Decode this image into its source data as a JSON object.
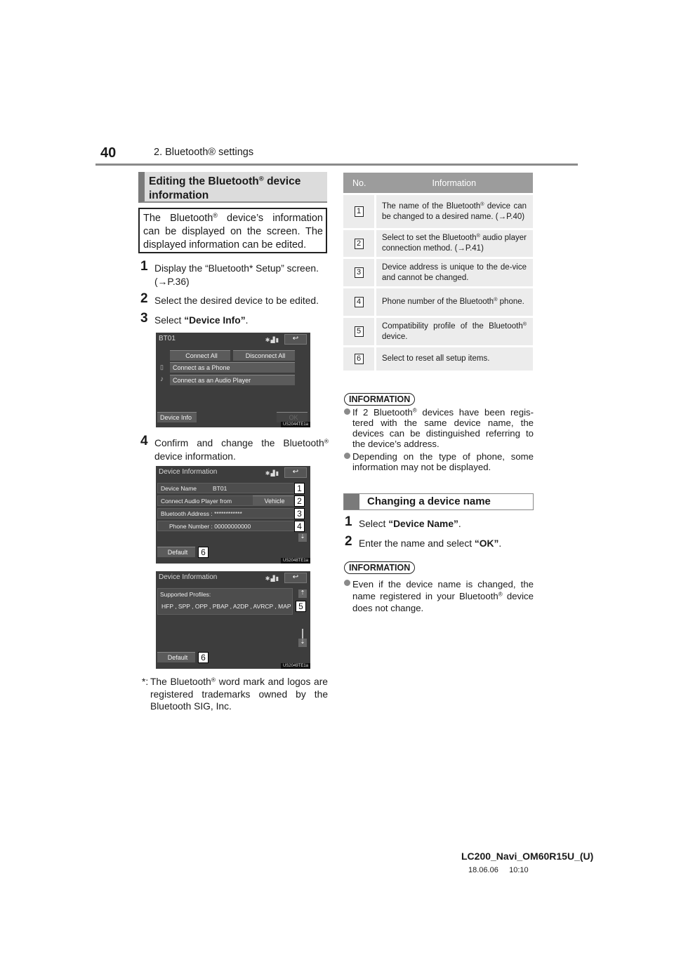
{
  "header": {
    "page_number": "40",
    "section_title": "2. Bluetooth® settings"
  },
  "left": {
    "heading_line1": "Editing the Bluetooth",
    "heading_sup": "®",
    "heading_line1_tail": " device",
    "heading_line2": "information",
    "intro": {
      "pre": "The Bluetooth",
      "sup": "®",
      "post": " device’s information can be displayed on the screen. The displayed information can be edited."
    },
    "steps": [
      {
        "num": "1",
        "text": "Display the “Bluetooth* Setup” screen.",
        "ref": "(→P.36)"
      },
      {
        "num": "2",
        "text": "Select the desired device to be edited."
      },
      {
        "num": "3",
        "pre": "Select ",
        "bold": "“Device Info”",
        "post": "."
      },
      {
        "num": "4",
        "pre": "Confirm and change the Bluetooth",
        "sup": "®",
        "post": "device information."
      }
    ],
    "screen1": {
      "title": "BT01",
      "status_icons": "bluetooth-signal-battery",
      "buttons": {
        "connect_all": "Connect All",
        "disconnect_all": "Disconnect All",
        "connect_phone": "Connect as a Phone",
        "connect_audio": "Connect as an Audio Player",
        "device_info": "Device Info",
        "ok": "OK"
      },
      "code": "US2044TE1a"
    },
    "screen2": {
      "title": "Device Information",
      "rows": {
        "device_name_label": "Device Name",
        "device_name_value": "BT01",
        "audio_label": "Connect Audio Player from",
        "audio_value": "Vehicle",
        "address": "Bluetooth Address : ************",
        "phone": "Phone Number : 00000000000"
      },
      "default_label": "Default",
      "tags": [
        "1",
        "2",
        "3",
        "4",
        "6"
      ],
      "code": "US2048TE1a"
    },
    "screen3": {
      "title": "Device Information",
      "profiles_label": "Supported Profiles:",
      "profiles": "HFP , SPP , OPP , PBAP , A2DP , AVRCP , MAP",
      "default_label": "Default",
      "tags": [
        "5",
        "6"
      ],
      "code": "US2049TE1a"
    },
    "footnote": {
      "star": "*:",
      "pre": "The Bluetooth",
      "sup": "®",
      "post": " word mark and logos are registered trademarks owned by the Bluetooth SIG, Inc."
    }
  },
  "table": {
    "headers": [
      "No.",
      "Information"
    ],
    "rows": [
      {
        "no": "1",
        "pre": "The name of the Bluetooth",
        "sup": "®",
        "post": " device can be changed to a desired name. (→P.40)"
      },
      {
        "no": "2",
        "pre": "Select to set the Bluetooth",
        "sup": "®",
        "post": " audio player connection method. (→P.41)"
      },
      {
        "no": "3",
        "pre": "Device address is unique to the de-vice and cannot be changed.",
        "sup": "",
        "post": ""
      },
      {
        "no": "4",
        "pre": "Phone number of the Bluetooth",
        "sup": "®",
        "post": " phone."
      },
      {
        "no": "5",
        "pre": "Compatibility profile of the Bluetooth",
        "sup": "®",
        "post": " device."
      },
      {
        "no": "6",
        "pre": "Select to reset all setup items.",
        "sup": "",
        "post": ""
      }
    ]
  },
  "information1": {
    "label": "INFORMATION",
    "bullets": [
      {
        "pre": "If 2 Bluetooth",
        "sup": "®",
        "post": " devices have been regis-tered with the same device name, the devices can be distinguished referring to the device’s address."
      },
      {
        "pre": "Depending on the type of phone, some information may not be displayed.",
        "sup": "",
        "post": ""
      }
    ]
  },
  "subsection": {
    "title": "Changing a device name",
    "steps": [
      {
        "num": "1",
        "pre": "Select ",
        "bold": "“Device Name”",
        "post": "."
      },
      {
        "num": "2",
        "pre": "Enter the name and select ",
        "bold": "“OK”",
        "post": "."
      }
    ]
  },
  "information2": {
    "label": "INFORMATION",
    "bullets": [
      {
        "pre": "Even if the device name is changed, the name registered in your Bluetooth",
        "sup": "®",
        "post": " device does not change."
      }
    ]
  },
  "footer": {
    "doc_id": "LC200_Navi_OM60R15U_(U)",
    "date": "18.06.06",
    "time": "10:10"
  }
}
